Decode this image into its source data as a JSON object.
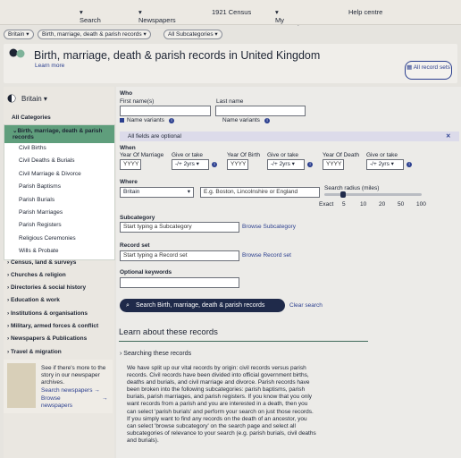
{
  "topnav": {
    "items": [
      "Search",
      "Newspapers",
      "1921 Census",
      "My research",
      "Help centre"
    ]
  },
  "breadcrumbs": [
    "Britain",
    "Birth, marriage, death & parish records",
    "All Subcategories"
  ],
  "header": {
    "title": "Birth, marriage, death & parish records in United Kingdom",
    "learn_more": "Learn more",
    "all_records": "All record sets"
  },
  "sidebar": {
    "country": "Britain",
    "all_categories": "All Categories",
    "active": "Birth, marriage, death & parish records",
    "subcategories": [
      "Civil Births",
      "Civil Deaths & Burials",
      "Civil Marriage & Divorce",
      "Parish Baptisms",
      "Parish Burials",
      "Parish Marriages",
      "Parish Registers",
      "Religious Ceremonies",
      "Wills & Probate"
    ],
    "categories": [
      "Census, land & surveys",
      "Churches & religion",
      "Directories & social history",
      "Education & work",
      "Institutions & organisations",
      "Military, armed forces & conflict",
      "Newspapers & Publications",
      "Travel & migration"
    ],
    "promo": {
      "text": "See if there's more to the story in our newspaper archives.",
      "link1": "Search newspapers",
      "link2": "Browse newspapers"
    }
  },
  "form": {
    "who": "Who",
    "first_names": "First name(s)",
    "last_name": "Last name",
    "name_variants": "Name variants",
    "notice": "All fields are optional",
    "when": "When",
    "year_marriage": "Year Of Marriage",
    "year_birth": "Year Of Birth",
    "year_death": "Year Of Death",
    "give_take": "Give or take",
    "yyyy": "YYYY",
    "range": "-/+ 2yrs",
    "where": "Where",
    "country": "Britain",
    "place_placeholder": "E.g. Boston, Lincolnshire or England",
    "radius_label": "Search radius (miles)",
    "radius_ticks": [
      "Exact",
      "5",
      "10",
      "20",
      "50",
      "100"
    ],
    "subcategory": "Subcategory",
    "subcategory_placeholder": "Start typing a Subcategory",
    "browse_sub": "Browse Subcategory",
    "record_set": "Record set",
    "record_placeholder": "Start typing a Record set",
    "browse_rec": "Browse Record set",
    "optional_keywords": "Optional keywords",
    "search_button": "Search Birth, marriage, death & parish records",
    "clear": "Clear search"
  },
  "learn": {
    "heading": "Learn about these records",
    "searching": "Searching these records",
    "paragraph": "We have split up our vital records by origin: civil records versus parish records. Civil records have been divided into official government births, deaths and burials, and civil marriage and divorce. Parish records have been broken into the following subcategories: parish baptisms, parish burials, parish marriages, and parish registers. If you know that you only want records from a parish and you are interested in a death, then you can select 'parish burials' and perform your search on just those records. If you simply want to find any records on the death of an ancestor, you can select 'browse subcategory' on the search page and select all subcategories of relevance to your search (e.g. parish burials, civil deaths and burials)."
  },
  "colors": {
    "accent": "#5f9e7c",
    "navy": "#1f2a4a",
    "link": "#2b3f8f"
  }
}
